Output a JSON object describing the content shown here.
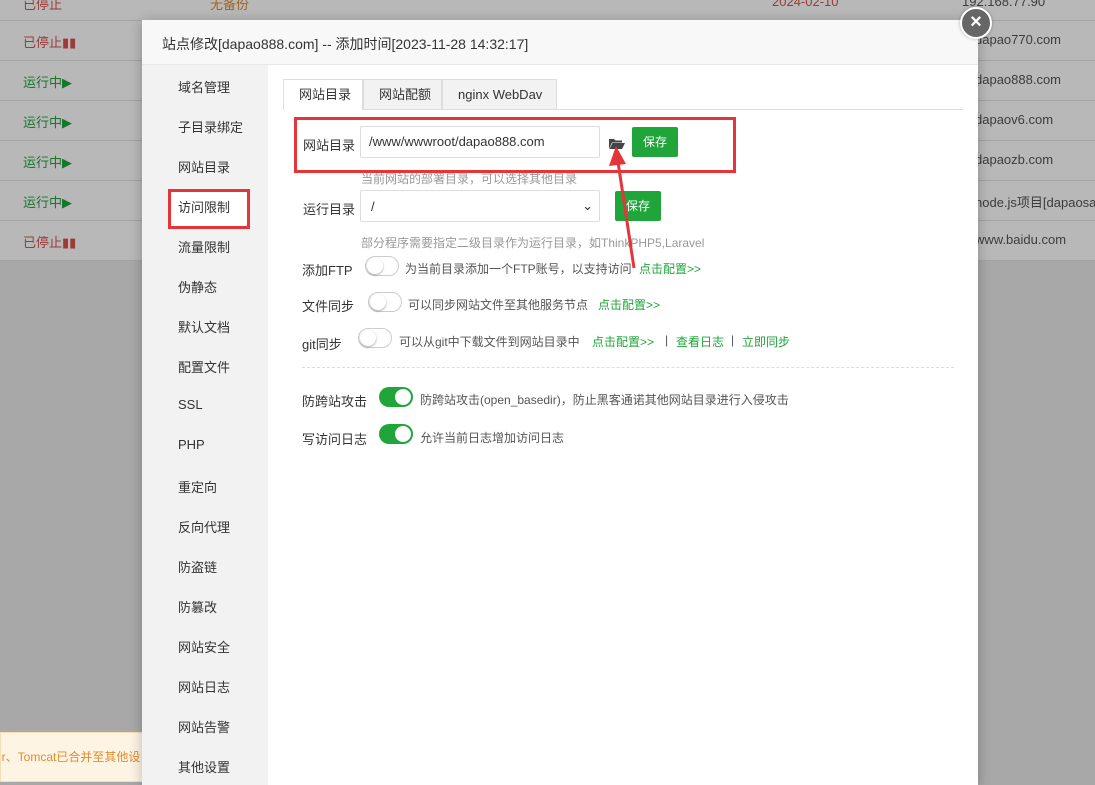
{
  "background_sites": {
    "top_row": {
      "status": "已停止",
      "backup": "无备份",
      "date": "2024-02-10",
      "ip": "192.168.77.90"
    },
    "rows": [
      {
        "status": "已停止",
        "state": "stopped",
        "domain": "dapao770.com"
      },
      {
        "status": "运行中",
        "state": "running",
        "domain": "dapao888.com"
      },
      {
        "status": "运行中",
        "state": "running",
        "domain": "dapaov6.com"
      },
      {
        "status": "运行中",
        "state": "running",
        "domain": "dapaozb.com"
      },
      {
        "status": "运行中",
        "state": "running",
        "domain": "node.js项目[dapaosao"
      },
      {
        "status": "已停止",
        "state": "stopped",
        "domain": "www.baidu.com"
      }
    ],
    "notice": "ser、Tomcat已合并至其他设"
  },
  "modal": {
    "title": "站点修改[dapao888.com] -- 添加时间[2023-11-28 14:32:17]",
    "close_icon": "close-icon",
    "nav": [
      "域名管理",
      "子目录绑定",
      "网站目录",
      "访问限制",
      "流量限制",
      "伪静态",
      "默认文档",
      "配置文件",
      "SSL",
      "PHP",
      "重定向",
      "反向代理",
      "防盗链",
      "防篡改",
      "网站安全",
      "网站日志",
      "网站告警",
      "其他设置"
    ],
    "active_nav": "网站目录",
    "tabs": [
      "网站目录",
      "网站配额",
      "nginx WebDav"
    ],
    "active_tab": "网站目录",
    "site_dir": {
      "label": "网站目录",
      "value": "/www/wwwroot/dapao888.com",
      "hint": "当前网站的部署目录，可以选择其他目录",
      "save": "保存"
    },
    "run_dir": {
      "label": "运行目录",
      "value": "/",
      "hint": "部分程序需要指定二级目录作为运行目录，如ThinkPHP5,Laravel",
      "save": "保存"
    },
    "ftp": {
      "label": "添加FTP",
      "enabled": false,
      "desc": "为当前目录添加一个FTP账号，以支持访问",
      "link": "点击配置>>"
    },
    "file_sync": {
      "label": "文件同步",
      "enabled": false,
      "desc": "可以同步网站文件至其他服务节点",
      "link": "点击配置>>"
    },
    "git_sync": {
      "label": "git同步",
      "enabled": false,
      "desc": "可以从git中下载文件到网站目录中",
      "link": "点击配置>>",
      "sep": "|",
      "link_log": "查看日志",
      "link_sync": "立即同步"
    },
    "anti_cross": {
      "label": "防跨站攻击",
      "enabled": true,
      "desc": "防跨站攻击(open_basedir)，防止黑客通诺其他网站目录进行入侵攻击"
    },
    "access_log": {
      "label": "写访问日志",
      "enabled": true,
      "desc": "允许当前日志增加访问日志"
    }
  },
  "colors": {
    "accent": "#20a53a",
    "annotation": "#e5353b",
    "stopped": "#d9534f"
  }
}
